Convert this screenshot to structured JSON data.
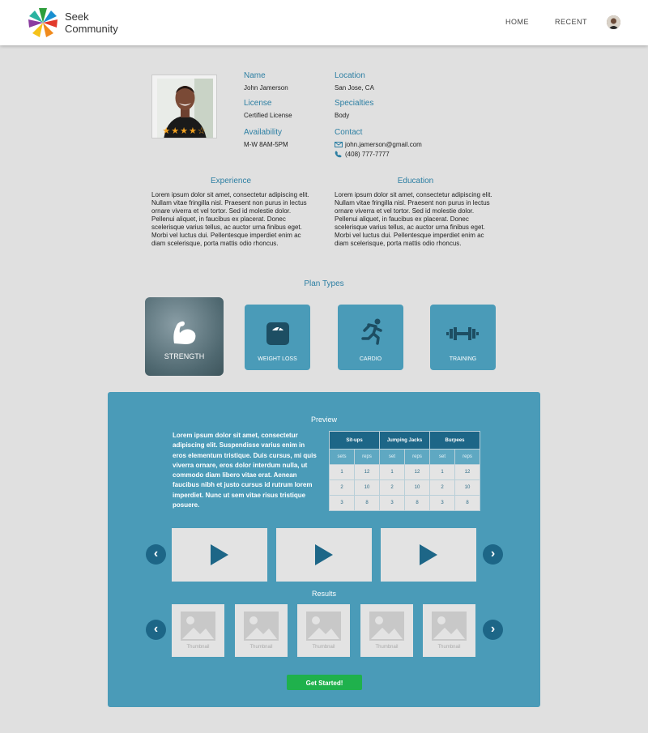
{
  "header": {
    "brand_line1": "Seek",
    "brand_line2": "Community",
    "nav": [
      {
        "label": "HOME"
      },
      {
        "label": "RECENT"
      }
    ]
  },
  "profile": {
    "rating": 4,
    "rating_max": 5,
    "name_label": "Name",
    "name": "John Jamerson",
    "location_label": "Location",
    "location": "San Jose, CA",
    "license_label": "License",
    "license": "Certified  License",
    "specialties_label": "Specialties",
    "specialties": "Body",
    "availability_label": "Availability",
    "availability": "M-W 8AM-5PM",
    "contact_label": "Contact",
    "email": "john.jamerson@gmail.com",
    "phone": "(408) 777-7777"
  },
  "experience": {
    "title": "Experience",
    "text": "Lorem ipsum dolor sit amet, consectetur adipiscing elit. Nullam vitae fringilla nisl. Praesent non purus in lectus ornare viverra et vel tortor. Sed id molestie dolor. Pellenui aliquet, in faucibus ex placerat. Donec scelerisque varius tellus, ac auctor urna finibus eget. Morbi vel luctus dui. Pellentesque imperdiet enim ac diam scelerisque, porta mattis odio rhoncus."
  },
  "education": {
    "title": "Education",
    "text": "Lorem ipsum dolor sit amet, consectetur adipiscing elit. Nullam vitae fringilla nisl. Praesent non purus in lectus ornare viverra et vel tortor. Sed id molestie dolor. Pellenui aliquet, in faucibus ex placerat. Donec scelerisque varius tellus, ac auctor urna finibus eget. Morbi vel luctus dui. Pellentesque imperdiet enim ac diam scelerisque, porta mattis odio rhoncus."
  },
  "plans": {
    "title": "Plan Types",
    "items": [
      {
        "label": "STRENGTH",
        "icon": "flexed-arm-icon"
      },
      {
        "label": "WEIGHT LOSS",
        "icon": "scale-icon"
      },
      {
        "label": "CARDIO",
        "icon": "runner-icon"
      },
      {
        "label": "TRAINING",
        "icon": "dumbbell-icon"
      }
    ]
  },
  "preview": {
    "title": "Preview",
    "text": "Lorem ipsum dolor sit amet, consectetur adipiscing elit. Suspendisse varius enim in eros elementum tristique. Duis cursus, mi quis viverra ornare, eros dolor interdum nulla, ut commodo diam libero vitae erat. Aenean faucibus nibh et justo cursus id rutrum lorem imperdiet. Nunc ut sem vitae risus tristique posuere.",
    "table": {
      "exercises": [
        "Sit-ups",
        "Jumping Jacks",
        "Burpees"
      ],
      "subheaders": [
        "sets",
        "reps",
        "set",
        "reps",
        "set",
        "reps"
      ],
      "rows": [
        [
          "1",
          "12",
          "1",
          "12",
          "1",
          "12"
        ],
        [
          "2",
          "10",
          "2",
          "10",
          "2",
          "10"
        ],
        [
          "3",
          "8",
          "3",
          "8",
          "3",
          "8"
        ]
      ]
    }
  },
  "results": {
    "title": "Results",
    "thumb_label": "Thumbnail"
  },
  "cta": {
    "label": "Get Started!"
  },
  "colors": {
    "accent": "#2d7fa3",
    "panel": "#4a9bb8",
    "dark": "#1d6687",
    "button": "#1fb14c",
    "star": "#f0a020"
  }
}
